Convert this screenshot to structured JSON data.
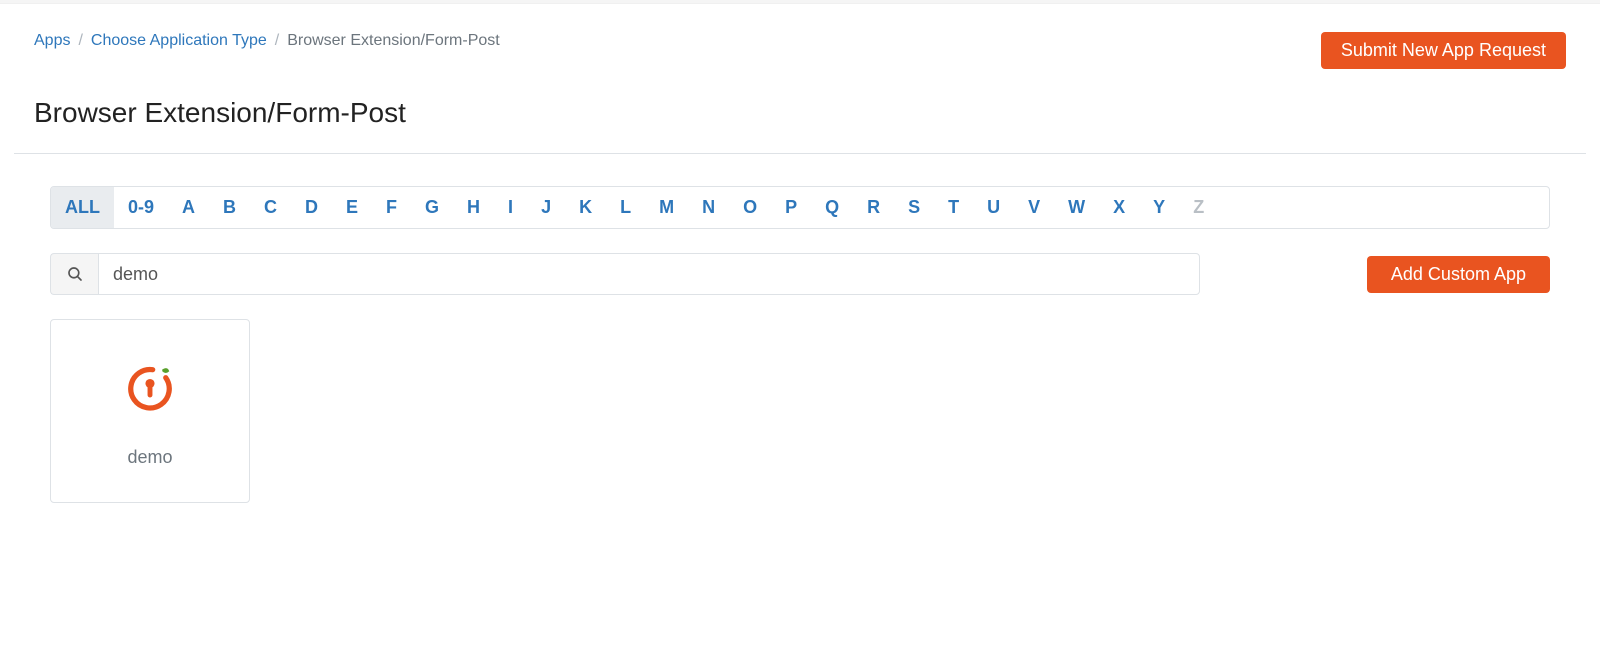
{
  "breadcrumb": {
    "apps": "Apps",
    "choose": "Choose Application Type",
    "current": "Browser Extension/Form-Post"
  },
  "header": {
    "submit_button": "Submit New App Request"
  },
  "title": "Browser Extension/Form-Post",
  "alpha_filter": {
    "items": [
      {
        "label": "ALL",
        "state": "selected"
      },
      {
        "label": "0-9",
        "state": "normal"
      },
      {
        "label": "A",
        "state": "normal"
      },
      {
        "label": "B",
        "state": "normal"
      },
      {
        "label": "C",
        "state": "normal"
      },
      {
        "label": "D",
        "state": "normal"
      },
      {
        "label": "E",
        "state": "normal"
      },
      {
        "label": "F",
        "state": "normal"
      },
      {
        "label": "G",
        "state": "normal"
      },
      {
        "label": "H",
        "state": "normal"
      },
      {
        "label": "I",
        "state": "normal"
      },
      {
        "label": "J",
        "state": "normal"
      },
      {
        "label": "K",
        "state": "normal"
      },
      {
        "label": "L",
        "state": "normal"
      },
      {
        "label": "M",
        "state": "normal"
      },
      {
        "label": "N",
        "state": "normal"
      },
      {
        "label": "O",
        "state": "normal"
      },
      {
        "label": "P",
        "state": "normal"
      },
      {
        "label": "Q",
        "state": "normal"
      },
      {
        "label": "R",
        "state": "normal"
      },
      {
        "label": "S",
        "state": "normal"
      },
      {
        "label": "T",
        "state": "normal"
      },
      {
        "label": "U",
        "state": "normal"
      },
      {
        "label": "V",
        "state": "normal"
      },
      {
        "label": "W",
        "state": "normal"
      },
      {
        "label": "X",
        "state": "normal"
      },
      {
        "label": "Y",
        "state": "normal"
      },
      {
        "label": "Z",
        "state": "disabled"
      }
    ]
  },
  "search": {
    "value": "demo",
    "placeholder": ""
  },
  "actions": {
    "add_custom_app": "Add Custom App"
  },
  "results": [
    {
      "name": "demo",
      "icon": "keyhole-circle-leaf"
    }
  ]
}
